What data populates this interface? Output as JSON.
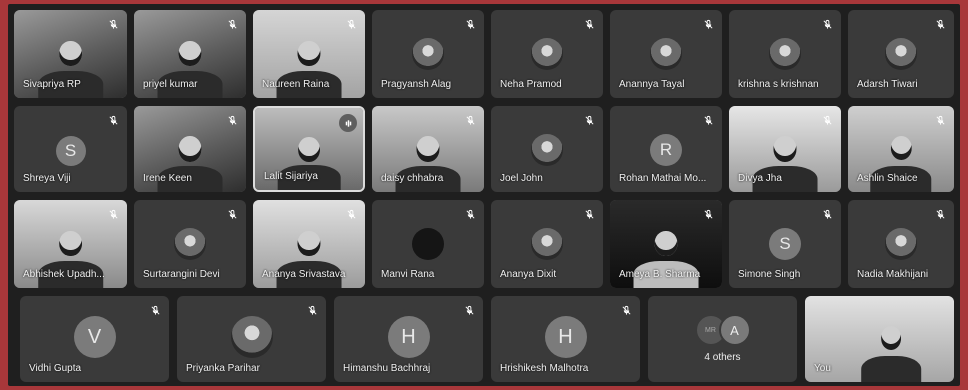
{
  "meeting": {
    "row1": [
      {
        "name": "Sivapriya RP",
        "type": "video"
      },
      {
        "name": "priyel kumar",
        "type": "video"
      },
      {
        "name": "Naureen Raina",
        "type": "video"
      },
      {
        "name": "Pragyansh Alag",
        "type": "avatar"
      },
      {
        "name": "Neha Pramod",
        "type": "avatar"
      },
      {
        "name": "Anannya Tayal",
        "type": "avatar"
      },
      {
        "name": "krishna s krishnan",
        "type": "avatar"
      },
      {
        "name": "Adarsh Tiwari",
        "type": "avatar"
      }
    ],
    "row2": [
      {
        "name": "Shreya Viji",
        "type": "letter",
        "letter": "S"
      },
      {
        "name": "Irene Keen",
        "type": "video"
      },
      {
        "name": "Lalit Sijariya",
        "type": "video",
        "speaking": true
      },
      {
        "name": "daisy chhabra",
        "type": "video"
      },
      {
        "name": "Joel John",
        "type": "avatar"
      },
      {
        "name": "Rohan Mathai Mo...",
        "type": "letter",
        "letter": "R"
      },
      {
        "name": "Divya Jha",
        "type": "video"
      },
      {
        "name": "Ashlin Shaice",
        "type": "video"
      }
    ],
    "row3": [
      {
        "name": "Abhishek Upadh...",
        "type": "video"
      },
      {
        "name": "Surtarangini Devi",
        "type": "avatar"
      },
      {
        "name": "Ananya Srivastava",
        "type": "video"
      },
      {
        "name": "Manvi Rana",
        "type": "avatar"
      },
      {
        "name": "Ananya Dixit",
        "type": "avatar"
      },
      {
        "name": "Ameya B. Sharma",
        "type": "video"
      },
      {
        "name": "Simone Singh",
        "type": "letter",
        "letter": "S"
      },
      {
        "name": "Nadia Makhijani",
        "type": "avatar"
      }
    ],
    "row4": [
      {
        "name": "Vidhi Gupta",
        "type": "letter",
        "letter": "V"
      },
      {
        "name": "Priyanka Parihar",
        "type": "avatar"
      },
      {
        "name": "Himanshu Bachhraj",
        "type": "letter",
        "letter": "H"
      },
      {
        "name": "Hrishikesh Malhotra",
        "type": "letter",
        "letter": "H"
      }
    ],
    "others": {
      "label": "4 others",
      "avatar1": "MR",
      "avatar2": "A"
    },
    "self": {
      "name": "You"
    }
  }
}
